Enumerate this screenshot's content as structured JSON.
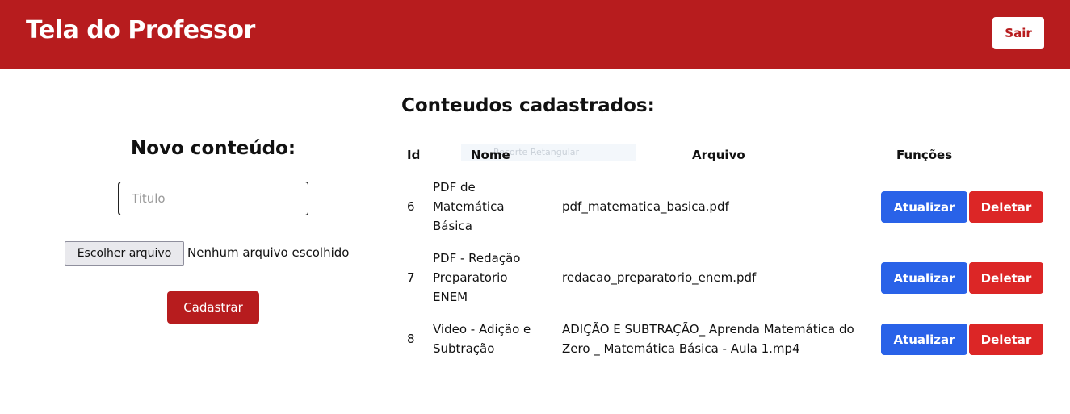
{
  "header": {
    "title": "Tela do Professor",
    "logout_label": "Sair"
  },
  "form": {
    "title": "Novo conteúdo:",
    "title_placeholder": "Titulo",
    "file_button_label": "Escolher arquivo",
    "file_status": "Nenhum arquivo escolhido",
    "submit_label": "Cadastrar"
  },
  "list": {
    "title": "Conteudos cadastrados:",
    "tooltip_ghost": "Recorte Retangular",
    "columns": {
      "id": "Id",
      "name": "Nome",
      "file": "Arquivo",
      "actions": "Funções"
    },
    "rows": [
      {
        "id": "6",
        "name": "PDF de Matemática Básica",
        "file": "pdf_matematica_basica.pdf",
        "update_label": "Atualizar",
        "delete_label": "Deletar"
      },
      {
        "id": "7",
        "name": "PDF - Redação Preparatorio ENEM",
        "file": "redacao_preparatorio_enem.pdf",
        "update_label": "Atualizar",
        "delete_label": "Deletar"
      },
      {
        "id": "8",
        "name": "Video - Adição e Subtração",
        "file": "ADIÇÃO E SUBTRAÇÃO_ Aprenda Matemática do Zero _ Matemática Básica - Aula 1.mp4",
        "update_label": "Atualizar",
        "delete_label": "Deletar"
      }
    ]
  },
  "colors": {
    "brand_red": "#b71c1e",
    "update_blue": "#2962e8",
    "delete_red": "#dc2626"
  }
}
